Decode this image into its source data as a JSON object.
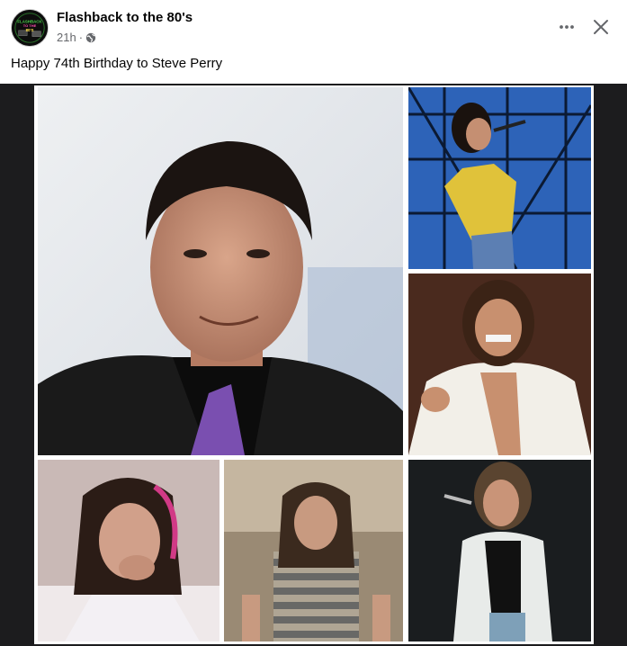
{
  "post": {
    "page_name": "Flashback to the 80's",
    "timestamp": "21h",
    "separator": "·",
    "audience_icon": "globe-icon",
    "caption": "Happy 74th Birthday to Steve Perry",
    "avatar_logo_lines": [
      "FLASHBACK",
      "TO THE",
      "80'S"
    ]
  },
  "actions": {
    "more_icon": "more-horizontal-icon",
    "close_icon": "close-icon"
  },
  "colors": {
    "name_text": "#050505",
    "meta_text": "#65676b",
    "media_background": "#1c1c1e"
  },
  "photos": [
    {
      "name": "photo-main-portrait",
      "subject": "older man in black suit with purple tie"
    },
    {
      "name": "photo-concert-scaffolding",
      "subject": "singer with microphone in yellow leopard shirt"
    },
    {
      "name": "photo-white-jacket",
      "subject": "singer in white jacket, long hair"
    },
    {
      "name": "photo-hand-on-chin",
      "subject": "young man with long hair, hand on chin"
    },
    {
      "name": "photo-striped-shirt",
      "subject": "singer in striped tank top"
    },
    {
      "name": "photo-vest-microphone",
      "subject": "singer in white vest holding microphone"
    }
  ]
}
